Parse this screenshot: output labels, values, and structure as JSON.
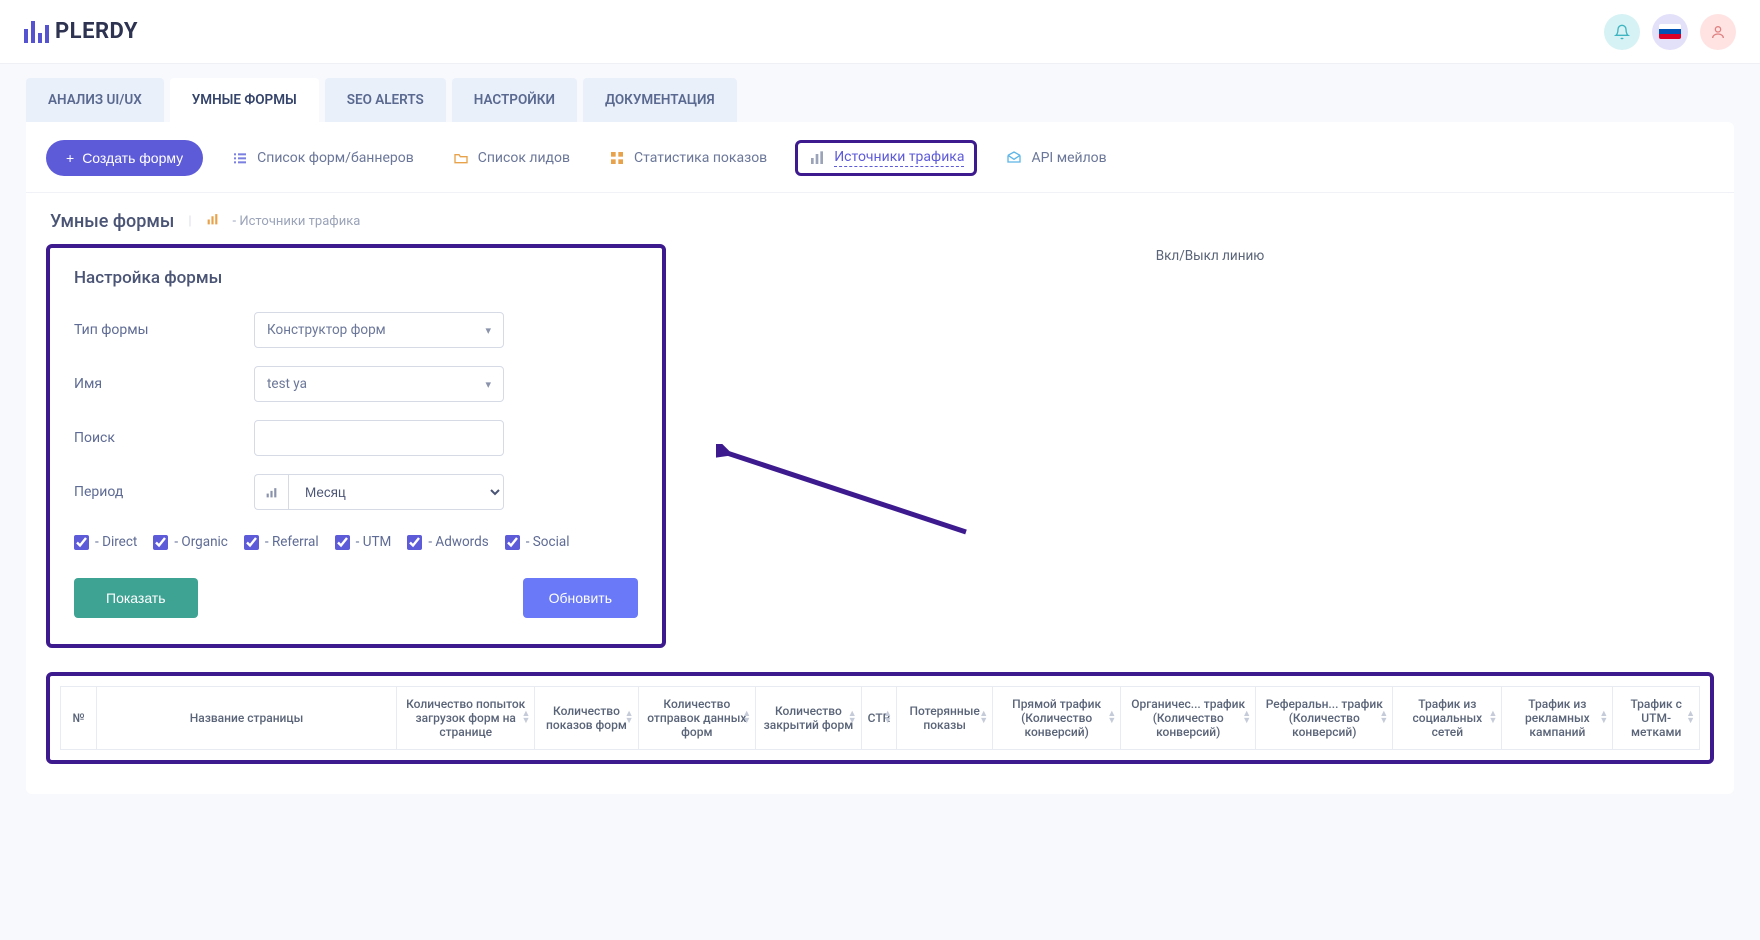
{
  "brand": "PLERDY",
  "tabs": [
    {
      "label": "АНАЛИЗ UI/UX",
      "active": false
    },
    {
      "label": "УМНЫЕ ФОРМЫ",
      "active": true
    },
    {
      "label": "SEO ALERTS",
      "active": false
    },
    {
      "label": "НАСТРОЙКИ",
      "active": false
    },
    {
      "label": "ДОКУМЕНТАЦИЯ",
      "active": false
    }
  ],
  "create_button": "Создать форму",
  "subnav": {
    "list_forms": "Список форм/баннеров",
    "list_leads": "Список лидов",
    "stats": "Статистика показов",
    "traffic": "Источники трафика",
    "api": "API мейлов"
  },
  "breadcrumb": {
    "title": "Умные формы",
    "trail": "- Источники трафика"
  },
  "panel": {
    "title": "Настройка формы",
    "labels": {
      "type": "Тип формы",
      "name": "Имя",
      "search": "Поиск",
      "period": "Период"
    },
    "values": {
      "type": "Конструктор форм",
      "name": "test ya",
      "search": "",
      "period": "Месяц"
    },
    "checks": [
      {
        "label": "- Direct"
      },
      {
        "label": "- Organic"
      },
      {
        "label": "- Referral"
      },
      {
        "label": "- UTM"
      },
      {
        "label": "- Adwords"
      },
      {
        "label": "- Social"
      }
    ],
    "show_btn": "Показать",
    "update_btn": "Обновить"
  },
  "legend_title": "Вкл/Выкл линию",
  "table_headers": [
    "№",
    "Название страницы",
    "Количество попыток загрузок форм на странице",
    "Количество показов форм",
    "Количество отправок данных форм",
    "Количество закрытий форм",
    "CTR",
    "Потерянные показы",
    "Прямой трафик (Количество конверсий)",
    "Органичес... трафик (Количество конверсий)",
    "Реферальн... трафик (Количество конверсий)",
    "Трафик из социальных сетей",
    "Трафик из рекламных кампаний",
    "Трафик с UTM-метками"
  ]
}
